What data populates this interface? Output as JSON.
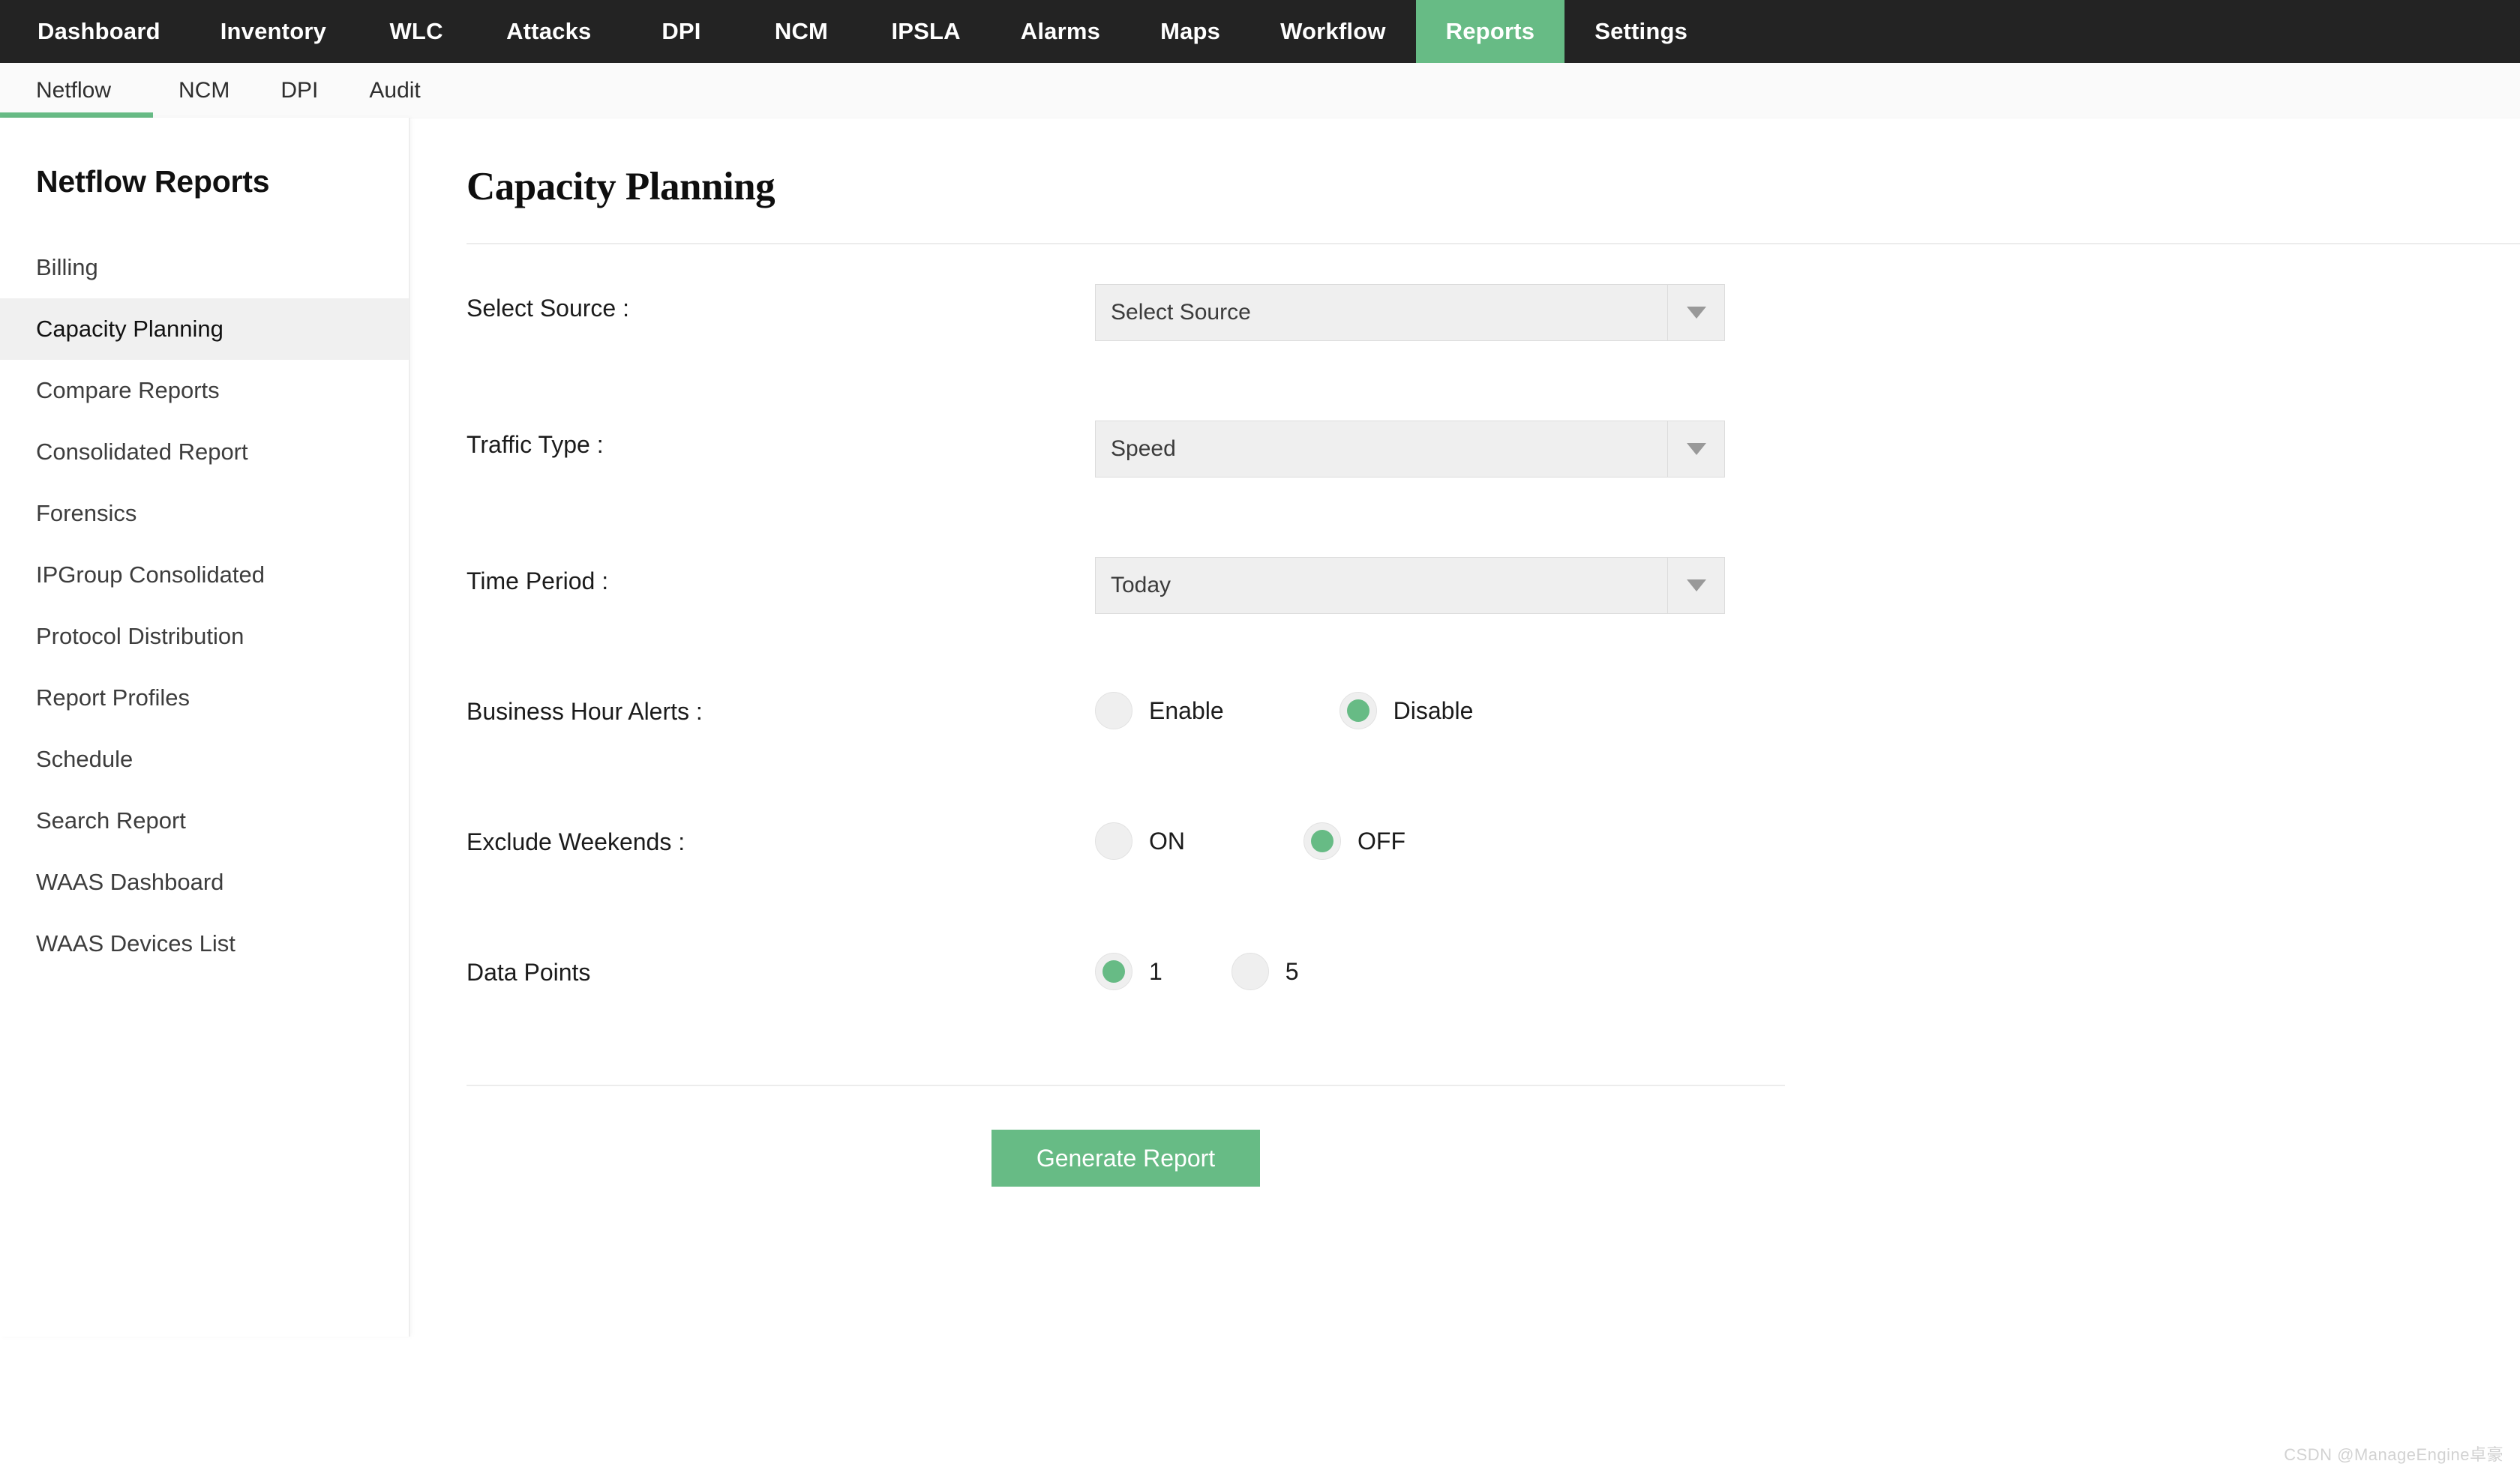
{
  "colors": {
    "accent": "#67bb85",
    "topnav_bg": "#232323",
    "sidebar_active_bg": "#f0f0f0",
    "field_bg": "#efefef"
  },
  "topnav": {
    "items": [
      {
        "label": "Dashboard",
        "active": false
      },
      {
        "label": "Inventory",
        "active": false
      },
      {
        "label": "WLC",
        "active": false
      },
      {
        "label": "Attacks",
        "active": false
      },
      {
        "label": "DPI",
        "active": false
      },
      {
        "label": "NCM",
        "active": false
      },
      {
        "label": "IPSLA",
        "active": false
      },
      {
        "label": "Alarms",
        "active": false
      },
      {
        "label": "Maps",
        "active": false
      },
      {
        "label": "Workflow",
        "active": false
      },
      {
        "label": "Reports",
        "active": true
      },
      {
        "label": "Settings",
        "active": false
      }
    ]
  },
  "subnav": {
    "items": [
      {
        "label": "Netflow",
        "active": true
      },
      {
        "label": "NCM",
        "active": false
      },
      {
        "label": "DPI",
        "active": false
      },
      {
        "label": "Audit",
        "active": false
      }
    ]
  },
  "sidebar": {
    "title": "Netflow Reports",
    "items": [
      {
        "label": "Billing",
        "active": false
      },
      {
        "label": "Capacity Planning",
        "active": true
      },
      {
        "label": "Compare Reports",
        "active": false
      },
      {
        "label": "Consolidated Report",
        "active": false
      },
      {
        "label": "Forensics",
        "active": false
      },
      {
        "label": "IPGroup Consolidated",
        "active": false
      },
      {
        "label": "Protocol Distribution",
        "active": false
      },
      {
        "label": "Report Profiles",
        "active": false
      },
      {
        "label": "Schedule",
        "active": false
      },
      {
        "label": "Search Report",
        "active": false
      },
      {
        "label": "WAAS Dashboard",
        "active": false
      },
      {
        "label": "WAAS Devices List",
        "active": false
      }
    ]
  },
  "main": {
    "title": "Capacity Planning",
    "fields": {
      "select_source": {
        "label": "Select Source :",
        "value": "Select Source",
        "arrow_icon": "chevron-down-icon"
      },
      "traffic_type": {
        "label": "Traffic Type :",
        "value": "Speed",
        "arrow_icon": "chevron-down-icon"
      },
      "time_period": {
        "label": "Time Period :",
        "value": "Today",
        "arrow_icon": "chevron-down-icon"
      },
      "business_hour_alerts": {
        "label": "Business Hour Alerts :",
        "options": [
          {
            "label": "Enable",
            "selected": false
          },
          {
            "label": "Disable",
            "selected": true
          }
        ]
      },
      "exclude_weekends": {
        "label": "Exclude Weekends :",
        "options": [
          {
            "label": "ON",
            "selected": false
          },
          {
            "label": "OFF",
            "selected": true
          }
        ]
      },
      "data_points": {
        "label": "Data Points",
        "options": [
          {
            "label": "1",
            "selected": true
          },
          {
            "label": "5",
            "selected": false
          }
        ]
      }
    },
    "generate_button": "Generate Report"
  },
  "watermark": "CSDN @ManageEngine卓豪"
}
